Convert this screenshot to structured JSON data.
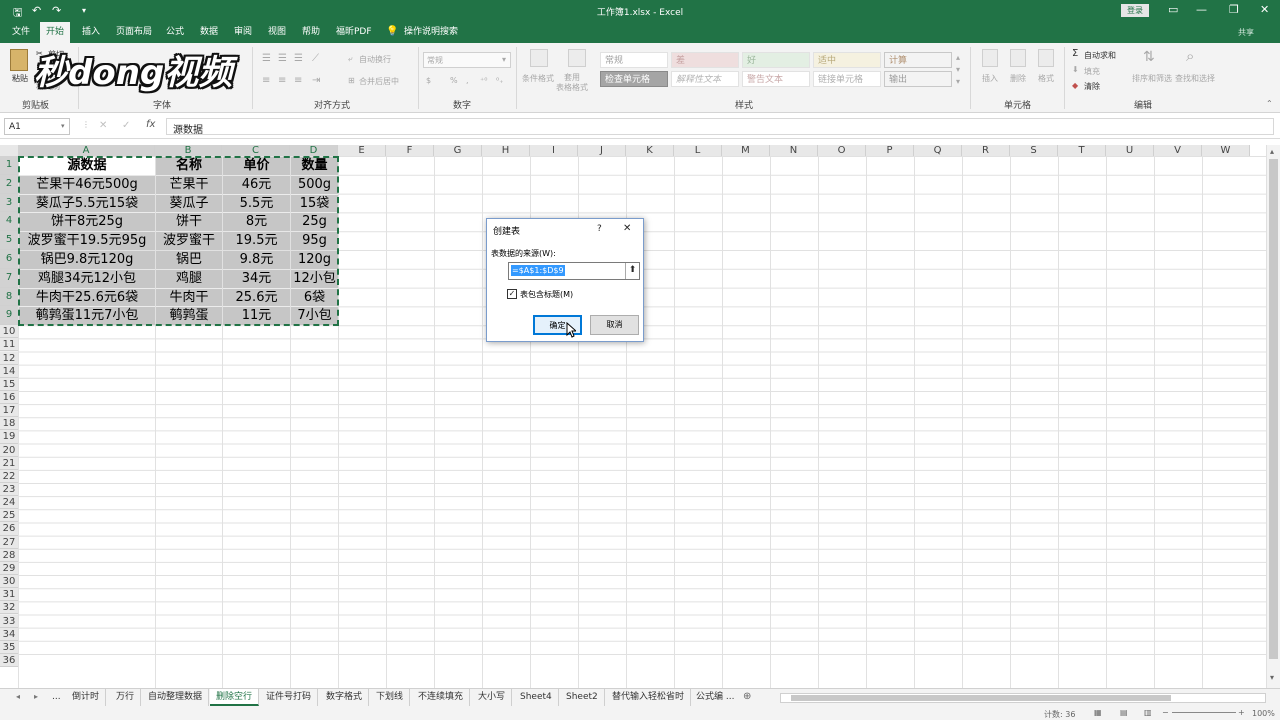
{
  "window": {
    "title": "工作簿1.xlsx  -  Excel",
    "login_label": "登录"
  },
  "watermark": "秒dong视频",
  "ribbon_tabs": [
    "文件",
    "开始",
    "插入",
    "页面布局",
    "公式",
    "数据",
    "审阅",
    "视图",
    "帮助",
    "福昕PDF"
  ],
  "tell_me": "操作说明搜索",
  "share_label": "共享",
  "ribbon": {
    "paste_label": "粘贴",
    "cut_label": "剪切",
    "format_painter_label": "格式刷",
    "clipboard_group": "剪贴板",
    "font_group": "字体",
    "alignment_group": "对齐方式",
    "wrap_text": "自动换行",
    "merge_center": "合并后居中",
    "number_group": "数字",
    "number_format": "常规",
    "percent_symbol": "%",
    "comma_symbol": ",",
    "styles_group": "样式",
    "conditional_format": "条件格式",
    "format_as_table": "套用\n表格格式",
    "styles": [
      [
        "常规",
        "差",
        "好",
        "适中",
        "计算"
      ],
      [
        "检查单元格",
        "解释性文本",
        "警告文本",
        "链接单元格",
        "输出"
      ]
    ],
    "cells_group": "单元格",
    "insert_label": "插入",
    "delete_label": "删除",
    "format_label": "格式",
    "editing_group": "编辑",
    "autosum": "自动求和",
    "fill": "填充",
    "clear": "清除",
    "sort_filter": "排序和筛选",
    "find_select": "查找和选择"
  },
  "formula_bar": {
    "name_box": "A1",
    "fx": "fx",
    "content": "源数据"
  },
  "columns": [
    "A",
    "B",
    "C",
    "D",
    "E",
    "F",
    "G",
    "H",
    "I",
    "J",
    "K",
    "L",
    "M",
    "N",
    "O",
    "P",
    "Q",
    "R",
    "S",
    "T",
    "U",
    "V",
    "W"
  ],
  "rows": [
    "1",
    "2",
    "3",
    "4",
    "5",
    "6",
    "7",
    "8",
    "9",
    "10",
    "11",
    "12",
    "14",
    "15",
    "16",
    "17",
    "18",
    "19",
    "20",
    "21",
    "22",
    "23",
    "24",
    "25",
    "26",
    "27",
    "28",
    "29",
    "30",
    "31",
    "32",
    "33",
    "34",
    "35",
    "36"
  ],
  "table": {
    "headers": [
      "源数据",
      "名称",
      "单价",
      "数量"
    ],
    "data": [
      [
        "芒果干46元500g",
        "芒果干",
        "46元",
        "500g"
      ],
      [
        "葵瓜子5.5元15袋",
        "葵瓜子",
        "5.5元",
        "15袋"
      ],
      [
        "饼干8元25g",
        "饼干",
        "8元",
        "25g"
      ],
      [
        "波罗蜜干19.5元95g",
        "波罗蜜干",
        "19.5元",
        "95g"
      ],
      [
        "锅巴9.8元120g",
        "锅巴",
        "9.8元",
        "120g"
      ],
      [
        "鸡腿34元12小包",
        "鸡腿",
        "34元",
        "12小包"
      ],
      [
        "牛肉干25.6元6袋",
        "牛肉干",
        "25.6元",
        "6袋"
      ],
      [
        "鹌鹑蛋11元7小包",
        "鹌鹑蛋",
        "11元",
        "7小包"
      ]
    ]
  },
  "dialog": {
    "title": "创建表",
    "help": "?",
    "close": "✕",
    "source_label": "表数据的来源(W):",
    "range_value": "=$A$1:$D$9",
    "has_headers_label": "表包含标题(M)",
    "ok": "确定",
    "cancel": "取消"
  },
  "sheet_tabs": [
    "...",
    "倒计时",
    "万行",
    "自动整理数据",
    "删除空行",
    "证件号打码",
    "数字格式",
    "下划线",
    "不连续填充",
    "大小写",
    "Sheet4",
    "Sheet2",
    "替代输入轻松省时",
    "公式编 ..."
  ],
  "active_sheet_index": 4,
  "status": {
    "count": "计数: 36",
    "zoom": "100%"
  },
  "colors": {
    "excel_green": "#217346",
    "ribbon_bg": "#f3f3f3",
    "selection_fill": "#c6c6c6",
    "marquee": "#217346"
  }
}
